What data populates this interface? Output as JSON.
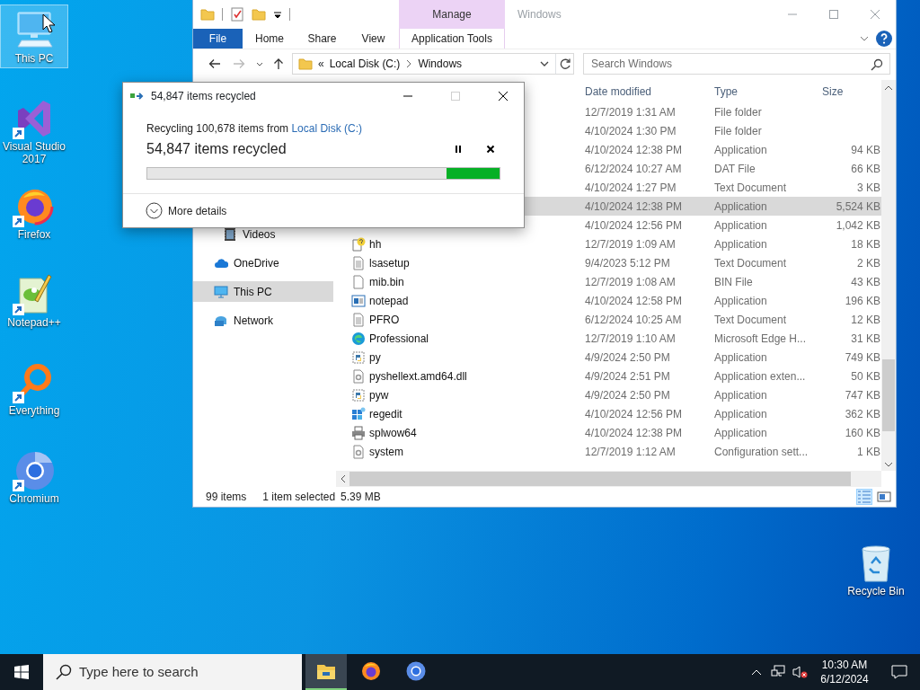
{
  "desktop": {
    "icons": [
      {
        "label": "This PC",
        "kind": "pc",
        "selected": true
      },
      {
        "label": "Visual Studio 2017",
        "kind": "vs",
        "selected": false
      },
      {
        "label": "Firefox",
        "kind": "firefox",
        "selected": false
      },
      {
        "label": "Notepad++",
        "kind": "notepadpp",
        "selected": false
      },
      {
        "label": "Everything",
        "kind": "everything",
        "selected": false
      },
      {
        "label": "Chromium",
        "kind": "chromium",
        "selected": false
      },
      {
        "label": "Recycle Bin",
        "kind": "recycle",
        "selected": false
      }
    ]
  },
  "explorer": {
    "title": "Windows",
    "contextual_group": "Manage",
    "ribbon_tabs": [
      {
        "label": "File",
        "kind": "file"
      },
      {
        "label": "Home",
        "kind": "tab"
      },
      {
        "label": "Share",
        "kind": "tab"
      },
      {
        "label": "View",
        "kind": "tab"
      },
      {
        "label": "Application Tools",
        "kind": "contextual"
      }
    ],
    "address": {
      "overflow": "«",
      "path": [
        "Local Disk (C:)",
        "Windows"
      ]
    },
    "search": {
      "placeholder": "Search Windows"
    },
    "nav_pane": [
      {
        "label": "Videos",
        "kind": "videos",
        "selected": false
      },
      {
        "label": "OneDrive",
        "kind": "onedrive",
        "selected": false
      },
      {
        "label": "This PC",
        "kind": "pc",
        "selected": true
      },
      {
        "label": "Network",
        "kind": "network",
        "selected": false
      }
    ],
    "columns": [
      "Date modified",
      "Type",
      "Size"
    ],
    "files": [
      {
        "date": "12/7/2019 1:31 AM",
        "type": "File folder",
        "selected": false
      },
      {
        "date": "4/10/2024 1:30 PM",
        "type": "File folder",
        "selected": false
      },
      {
        "date": "4/10/2024 12:38 PM",
        "type": "Application",
        "size": "94 KB",
        "selected": false
      },
      {
        "date": "6/12/2024 10:27 AM",
        "type": "DAT File",
        "size": "66 KB",
        "selected": false
      },
      {
        "date": "4/10/2024 1:27 PM",
        "type": "Text Document",
        "size": "3 KB",
        "selected": false
      },
      {
        "date": "4/10/2024 12:38 PM",
        "type": "Application",
        "size": "5,524 KB",
        "selected": true
      },
      {
        "date": "4/10/2024 12:56 PM",
        "type": "Application",
        "size": "1,042 KB",
        "selected": false
      },
      {
        "name": "hh",
        "kind": "help",
        "date": "12/7/2019 1:09 AM",
        "type": "Application",
        "size": "18 KB",
        "selected": false
      },
      {
        "name": "lsasetup",
        "kind": "text",
        "date": "9/4/2023 5:12 PM",
        "type": "Text Document",
        "size": "2 KB",
        "selected": false
      },
      {
        "name": "mib.bin",
        "kind": "file",
        "date": "12/7/2019 1:08 AM",
        "type": "BIN File",
        "size": "43 KB",
        "selected": false
      },
      {
        "name": "notepad",
        "kind": "app",
        "date": "4/10/2024 12:58 PM",
        "type": "Application",
        "size": "196 KB",
        "selected": false
      },
      {
        "name": "PFRO",
        "kind": "text",
        "date": "6/12/2024 10:25 AM",
        "type": "Text Document",
        "size": "12 KB",
        "selected": false
      },
      {
        "name": "Professional",
        "kind": "edge",
        "date": "12/7/2019 1:10 AM",
        "type": "Microsoft Edge H...",
        "size": "31 KB",
        "selected": false
      },
      {
        "name": "py",
        "kind": "python",
        "date": "4/9/2024 2:50 PM",
        "type": "Application",
        "size": "749 KB",
        "selected": false
      },
      {
        "name": "pyshellext.amd64.dll",
        "kind": "dll",
        "date": "4/9/2024 2:51 PM",
        "type": "Application exten...",
        "size": "50 KB",
        "selected": false
      },
      {
        "name": "pyw",
        "kind": "python",
        "date": "4/9/2024 2:50 PM",
        "type": "Application",
        "size": "747 KB",
        "selected": false
      },
      {
        "name": "regedit",
        "kind": "regedit",
        "date": "4/10/2024 12:56 PM",
        "type": "Application",
        "size": "362 KB",
        "selected": false
      },
      {
        "name": "splwow64",
        "kind": "printer",
        "date": "4/10/2024 12:38 PM",
        "type": "Application",
        "size": "160 KB",
        "selected": false
      },
      {
        "name": "system",
        "kind": "dll",
        "date": "12/7/2019 1:12 AM",
        "type": "Configuration sett...",
        "size": "1 KB",
        "selected": false
      }
    ],
    "status_bar": {
      "item_count": "99 items",
      "selection": "1 item selected",
      "selection_size": "5.39 MB"
    },
    "views": [
      {
        "kind": "details",
        "selected": true
      },
      {
        "kind": "tiles",
        "selected": false
      }
    ]
  },
  "dialog": {
    "title": "54,847 items recycled",
    "maximize_disabled": true,
    "message": "Recycling 100,678 items from ",
    "source_link": "Local Disk (C:)",
    "heading": "54,847 items recycled",
    "level": 0.15,
    "more_details": "More details"
  },
  "taskbar": {
    "search": {
      "placeholder": "Type here to search"
    },
    "apps": [
      {
        "kind": "explorer",
        "selected": true
      },
      {
        "kind": "firefox",
        "selected": false
      },
      {
        "kind": "chromium",
        "selected": false
      }
    ],
    "volume_muted": true,
    "clock": {
      "time": "10:30 AM",
      "date": "6/12/2024"
    }
  }
}
